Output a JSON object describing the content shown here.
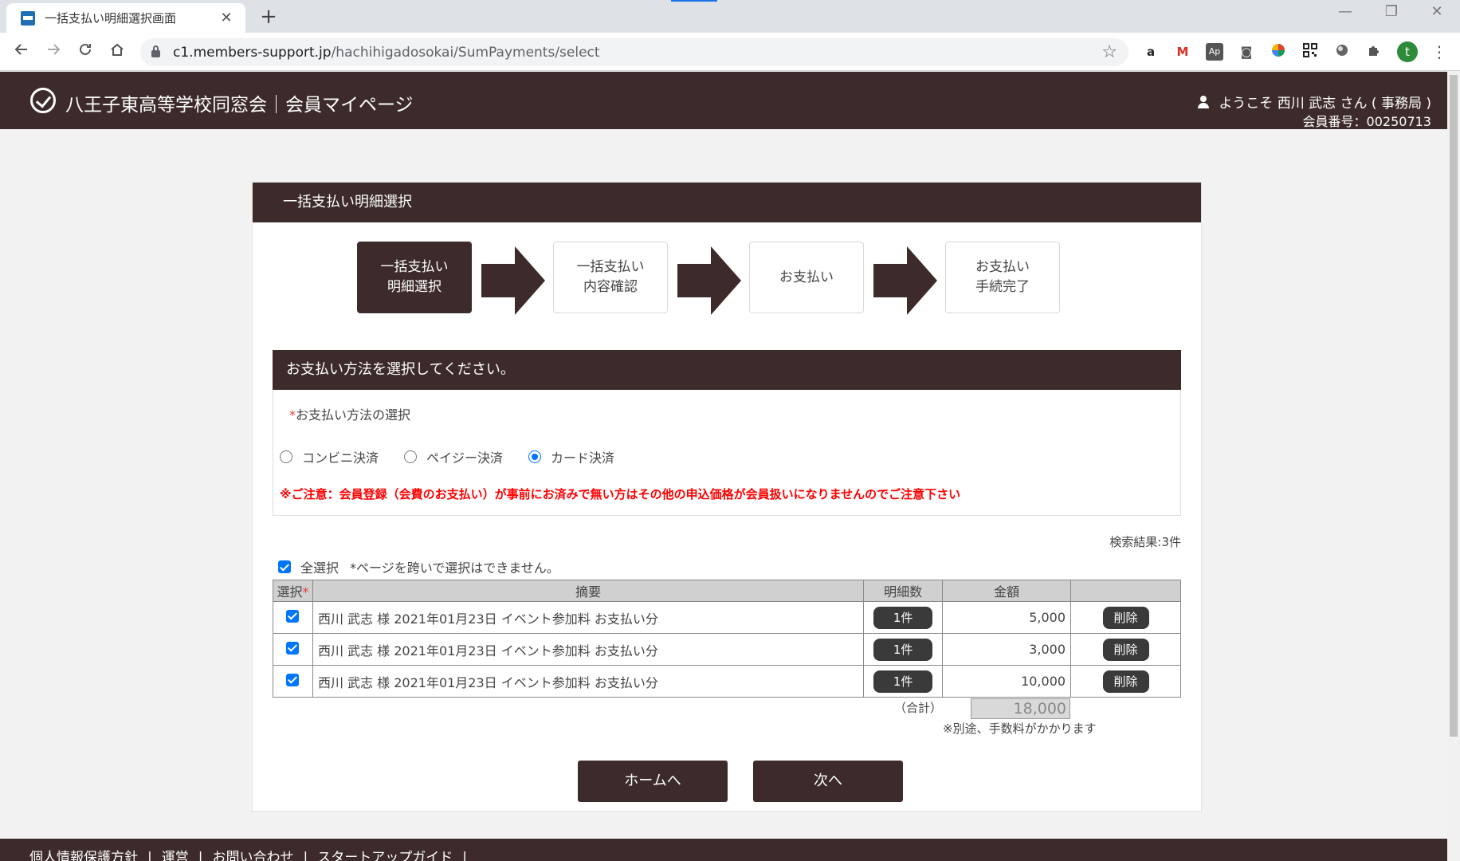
{
  "browser": {
    "tab_title": "一括支払い明細選択画面",
    "tab_close": "✕",
    "new_tab": "+",
    "url_host": "c1.members-support.jp",
    "url_path": "/hachihigadosokai/SumPayments/select",
    "profile_initial": "t",
    "window_controls": [
      "—",
      "❐",
      "✕"
    ]
  },
  "header": {
    "site_title": "八王子東高等学校同窓会｜会員マイページ",
    "welcome": "ようこそ 西川 武志 さん ( 事務局 )",
    "member_no": "会員番号：00250713"
  },
  "page": {
    "card_title": "一括支払い明細選択",
    "steps": [
      {
        "line1": "一括支払い",
        "line2": "明細選択",
        "active": true
      },
      {
        "line1": "一括支払い",
        "line2": "内容確認",
        "active": false
      },
      {
        "line1": "お支払い",
        "line2": "",
        "active": false
      },
      {
        "line1": "お支払い",
        "line2": "手続完了",
        "active": false
      }
    ],
    "section_title": "お支払い方法を選択してください。",
    "required_mark": "*",
    "method_label": "お支払い方法の選択",
    "methods": [
      {
        "label": "コンビニ決済",
        "checked": false
      },
      {
        "label": "ペイジー決済",
        "checked": false
      },
      {
        "label": "カード決済",
        "checked": true
      }
    ],
    "notice": "※ご注意：会員登録（会費のお支払い）が事前にお済みで無い方はその他の申込価格が会員扱いになりませんのでご注意下さい",
    "search_result": "検索結果:3件",
    "select_all_label": "全選択",
    "select_all_note": "*ページを跨いで選択はできません。",
    "table": {
      "headers": {
        "select": "選択",
        "summary": "摘要",
        "count": "明細数",
        "amount": "金額",
        "action": ""
      },
      "rows": [
        {
          "checked": true,
          "summary": "西川 武志 様 2021年01月23日 イベント参加料 お支払い分",
          "count": "1件",
          "amount": "5,000",
          "action": "削除"
        },
        {
          "checked": true,
          "summary": "西川 武志 様 2021年01月23日 イベント参加料 お支払い分",
          "count": "1件",
          "amount": "3,000",
          "action": "削除"
        },
        {
          "checked": true,
          "summary": "西川 武志 様 2021年01月23日 イベント参加料 お支払い分",
          "count": "1件",
          "amount": "10,000",
          "action": "削除"
        }
      ]
    },
    "total_label": "（合計）",
    "total_value": "18,000",
    "fee_note": "※別途、手数料がかかります",
    "home_button": "ホームへ",
    "next_button": "次へ"
  },
  "footer": {
    "links": [
      "個人情報保護方針",
      "運営",
      "お問い合わせ",
      "スタートアップガイド"
    ],
    "separator": "|"
  },
  "colors": {
    "brand": "#3d2b2b",
    "notice": "#ff0000",
    "accent": "#0075ff"
  }
}
